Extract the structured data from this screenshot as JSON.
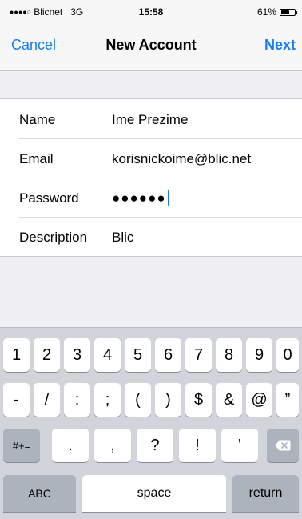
{
  "status": {
    "carrier": "Blicnet",
    "network": "3G",
    "time": "15:58",
    "battery_text": "61%",
    "battery_level": 0.61
  },
  "nav": {
    "cancel": "Cancel",
    "title": "New Account",
    "next": "Next"
  },
  "form": {
    "rows": [
      {
        "label": "Name",
        "value": "Ime Prezime"
      },
      {
        "label": "Email",
        "value": "korisnickoime@blic.net"
      },
      {
        "label": "Password",
        "value": "●●●●●●"
      },
      {
        "label": "Description",
        "value": "Blic"
      }
    ]
  },
  "keyboard": {
    "row1": [
      "1",
      "2",
      "3",
      "4",
      "5",
      "6",
      "7",
      "8",
      "9",
      "0"
    ],
    "row2": [
      "-",
      "/",
      ":",
      ";",
      "(",
      ")",
      "$",
      "&",
      "@",
      "”"
    ],
    "row3": [
      "#+=",
      ".",
      ",",
      "?",
      "!",
      "’"
    ],
    "row4": [
      "ABC",
      "space",
      "return"
    ],
    "backspace_icon": "backspace-icon"
  }
}
